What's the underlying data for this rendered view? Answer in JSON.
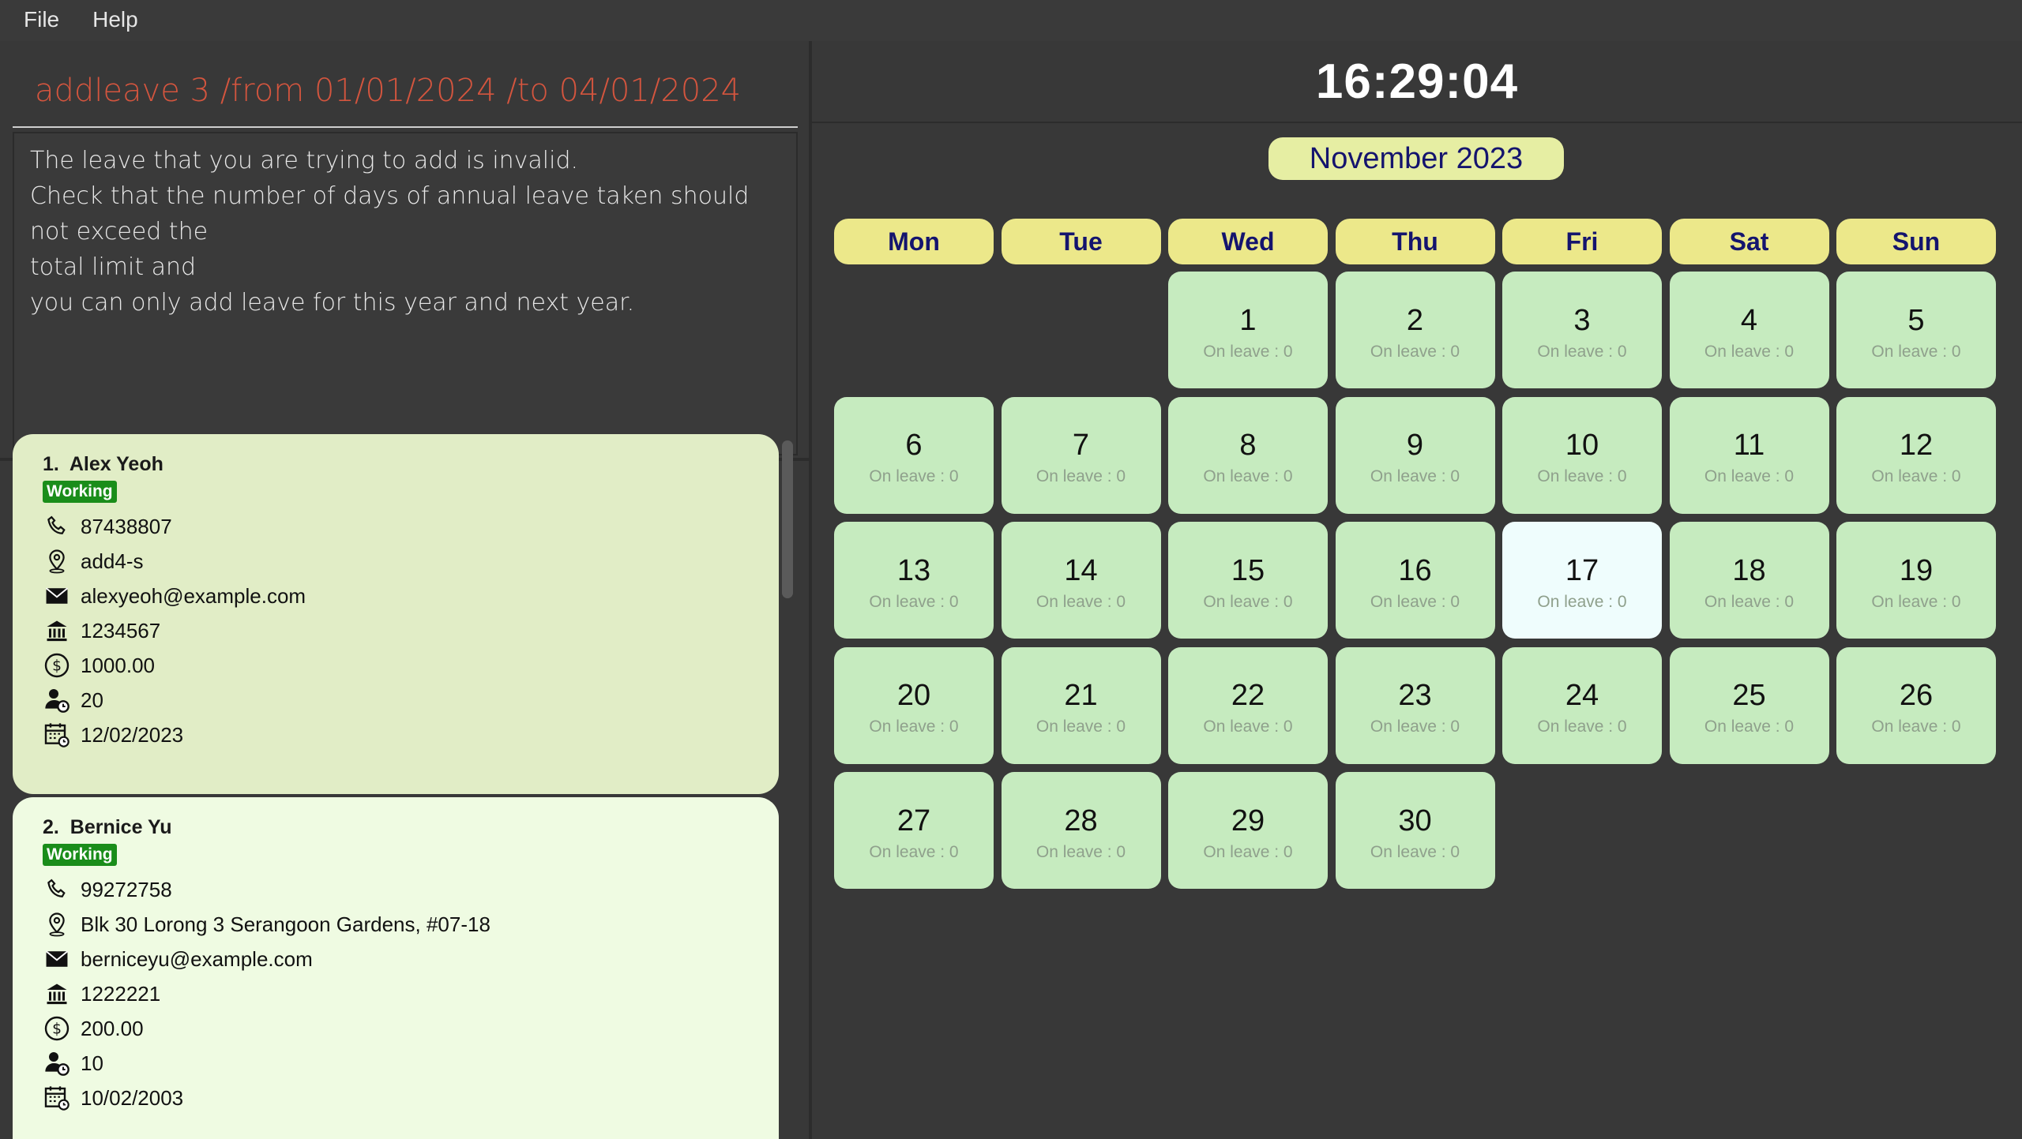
{
  "menu": {
    "file": "File",
    "help": "Help"
  },
  "command": "addleave 3 /from 01/01/2024 /to 04/01/2024",
  "result": [
    "The leave that you are trying to add is invalid.",
    "Check that the number of days of annual leave taken should not exceed the",
    "total limit and",
    "you can only add leave for this year and next year."
  ],
  "persons": [
    {
      "index": "1.",
      "name": "Alex Yeoh",
      "status": "Working",
      "phone": "87438807",
      "address": "add4-s",
      "email": "alexyeoh@example.com",
      "bank": "1234567",
      "salary": "1000.00",
      "leave": "20",
      "join_date": "12/02/2023"
    },
    {
      "index": "2.",
      "name": "Bernice Yu",
      "status": "Working",
      "phone": "99272758",
      "address": "Blk 30 Lorong 3 Serangoon Gardens, #07-18",
      "email": "berniceyu@example.com",
      "bank": "1222221",
      "salary": "200.00",
      "leave": "10",
      "join_date": "10/02/2003"
    }
  ],
  "clock": "16:29:04",
  "calendar": {
    "month_label": "November 2023",
    "weekdays": [
      "Mon",
      "Tue",
      "Wed",
      "Thu",
      "Fri",
      "Sat",
      "Sun"
    ],
    "first_weekday_index": 2,
    "days_in_month": 30,
    "today": 17,
    "leave_label": "On leave : 0"
  },
  "colors": {
    "command_error": "#d4553e",
    "badge_working": "#1a8d1a",
    "day_cell": "#c6ebbf",
    "today_cell": "#effdfd",
    "weekday_header": "#ece88a"
  },
  "icons": [
    "phone-icon",
    "location-icon",
    "email-icon",
    "bank-icon",
    "dollar-icon",
    "person-clock-icon",
    "calendar-clock-icon"
  ]
}
